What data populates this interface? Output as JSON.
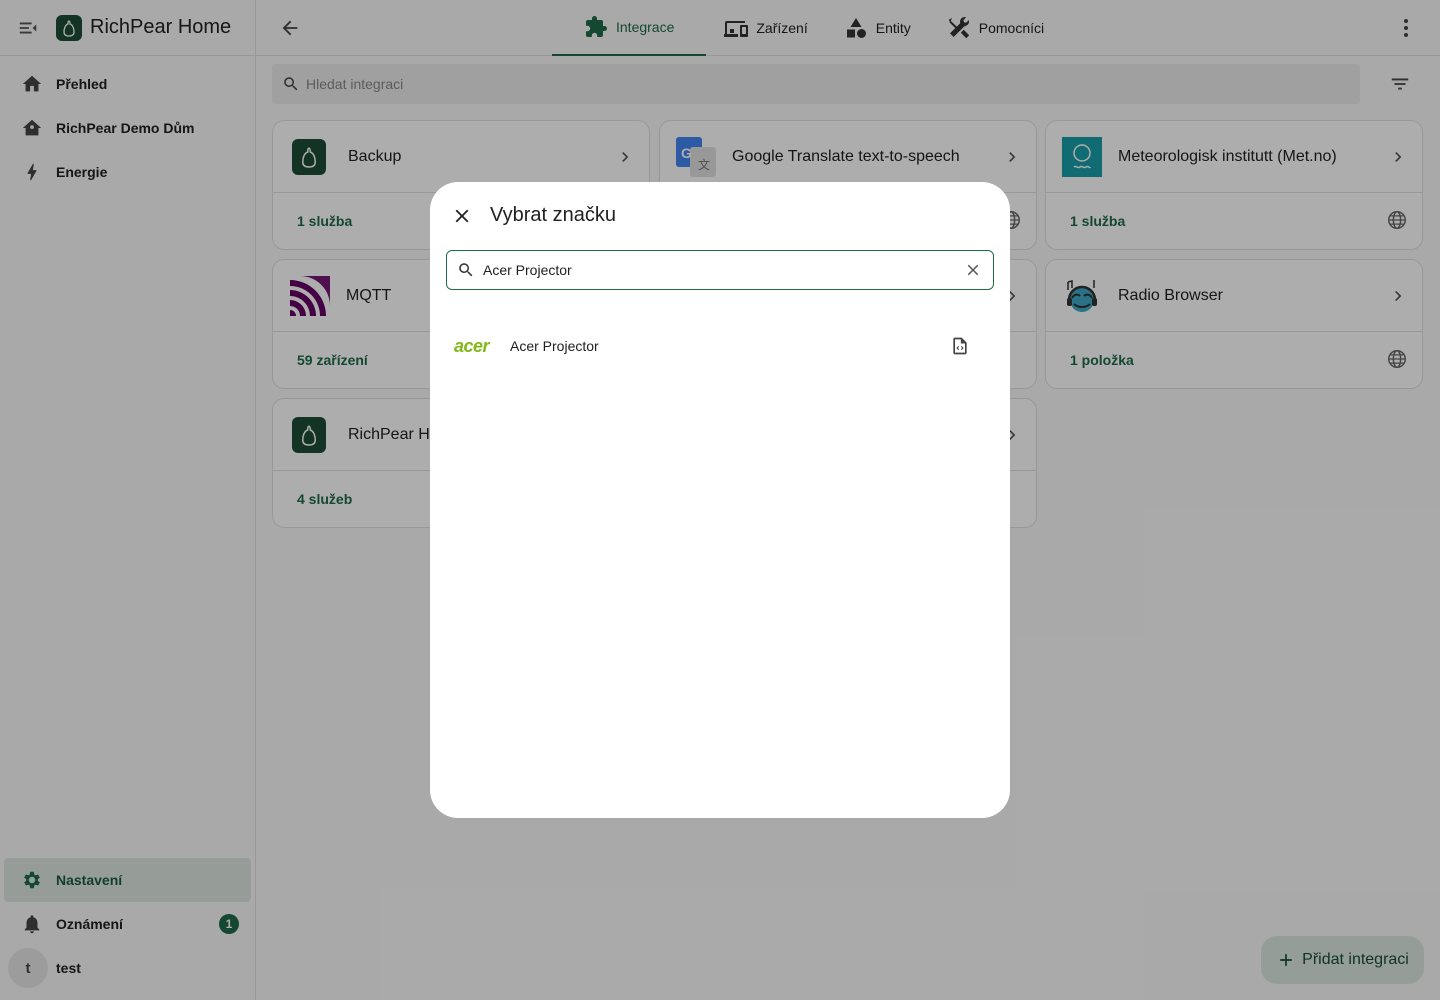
{
  "app": {
    "title": "RichPear Home"
  },
  "sidebar": {
    "items": [
      {
        "label": "Přehled",
        "icon": "home-icon"
      },
      {
        "label": "RichPear Demo Dům",
        "icon": "home-outline-icon"
      },
      {
        "label": "Energie",
        "icon": "lightning-icon"
      }
    ],
    "bottom": [
      {
        "label": "Nastavení",
        "icon": "gear-icon",
        "active": true
      },
      {
        "label": "Oznámení",
        "icon": "bell-icon",
        "badge": "1"
      },
      {
        "label": "test",
        "avatar": "t"
      }
    ]
  },
  "topbar": {
    "tabs": [
      {
        "label": "Integrace",
        "icon": "puzzle-icon",
        "active": true
      },
      {
        "label": "Zařízení",
        "icon": "devices-icon"
      },
      {
        "label": "Entity",
        "icon": "shapes-icon"
      },
      {
        "label": "Pomocníci",
        "icon": "tools-icon"
      }
    ]
  },
  "search": {
    "placeholder": "Hledat integraci"
  },
  "cards": [
    {
      "name": "Backup",
      "footer": "1 služba",
      "logo": "richpear-logo",
      "globe": false
    },
    {
      "name": "Google Translate text-to-speech",
      "footer": "",
      "logo": "google-translate-logo",
      "globe": true
    },
    {
      "name": "Meteorologisk institutt (Met.no)",
      "footer": "1 služba",
      "logo": "met-no-logo",
      "globe": true
    },
    {
      "name": "MQTT",
      "footer": "59 zařízení",
      "logo": "mqtt-logo",
      "globe": false
    },
    {
      "name": "",
      "footer": "",
      "logo": "",
      "globe": false
    },
    {
      "name": "Radio Browser",
      "footer": "1 položka",
      "logo": "radio-browser-logo",
      "globe": true
    },
    {
      "name": "RichPear Home",
      "footer": "4 služeb",
      "logo": "richpear-logo",
      "globe": false
    },
    {
      "name": "",
      "footer": "",
      "logo": "",
      "globe": false
    }
  ],
  "dialog": {
    "title": "Vybrat značku",
    "search_value": "Acer Projector",
    "results": [
      {
        "brand_logo_text": "acer",
        "name": "Acer Projector",
        "icon": "file-code-icon"
      }
    ]
  },
  "fab": {
    "label": "Přidat integraci"
  },
  "colors": {
    "primary": "#1e6b47",
    "active_bg": "#dde8e2",
    "scrim": "rgba(0,0,0,0.32)"
  }
}
